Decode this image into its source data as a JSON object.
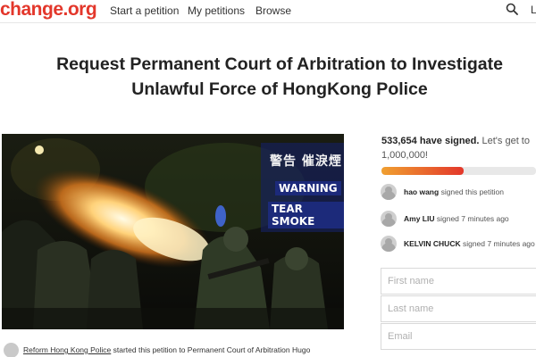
{
  "header": {
    "logo": "change.org",
    "nav": [
      "Start a petition",
      "My petitions",
      "Browse"
    ],
    "search_icon": "search-icon",
    "login_partial": "L"
  },
  "petition": {
    "title_line1": "Request Permanent Court of Arbitration to Investigate",
    "title_line2": "Unlawful Force of HongKong Police",
    "photo": {
      "sign_chinese": "警告 催淚煙",
      "sign_warning": "WARNING",
      "sign_tear_smoke": "TEAR SMOKE"
    },
    "starter": {
      "name": "Reform Hong Kong Police",
      "text": " started this petition to Permanent Court of Arbitration Hugo"
    }
  },
  "sidebar": {
    "signed_count": "533,654 have signed.",
    "goal_text": " Let's get to 1,000,000!",
    "progress_fraction": 0.53,
    "progress_colors": [
      "#f0a030",
      "#e3372b"
    ],
    "recent_signers": [
      {
        "name": "hao wang",
        "action": " signed this petition"
      },
      {
        "name": "Amy LIU",
        "action": " signed 7 minutes ago"
      },
      {
        "name": "KELVIN CHUCK",
        "action": " signed 7 minutes ago"
      }
    ],
    "form": {
      "first_name_placeholder": "First name",
      "last_name_placeholder": "Last name",
      "email_placeholder": "Email"
    }
  },
  "colors": {
    "brand": "#e3372b"
  }
}
